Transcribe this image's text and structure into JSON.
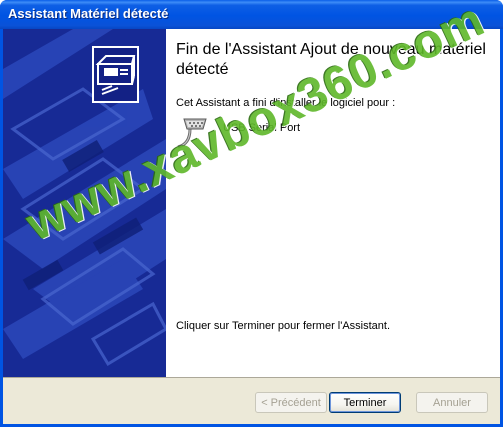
{
  "window": {
    "title": "Assistant Matériel détecté"
  },
  "content": {
    "heading": "Fin de l'Assistant Ajout de nouveau matériel détecté",
    "subtext": "Cet Assistant a fini d'installer le logiciel pour :",
    "device_name": "USB Serial Port",
    "finish_text": "Cliquer sur Terminer pour fermer l'Assistant."
  },
  "buttons": {
    "back": "< Précédent",
    "finish": "Terminer",
    "cancel": "Annuler"
  },
  "watermark": "www.xavbox360.com",
  "colors": {
    "titlebar": "#0054e3",
    "banner": "#172a95",
    "footer": "#ece9d8",
    "watermark": "#5fb82a"
  },
  "icons": {
    "wizard": "hardware-wizard-icon",
    "device": "serial-port-icon"
  }
}
